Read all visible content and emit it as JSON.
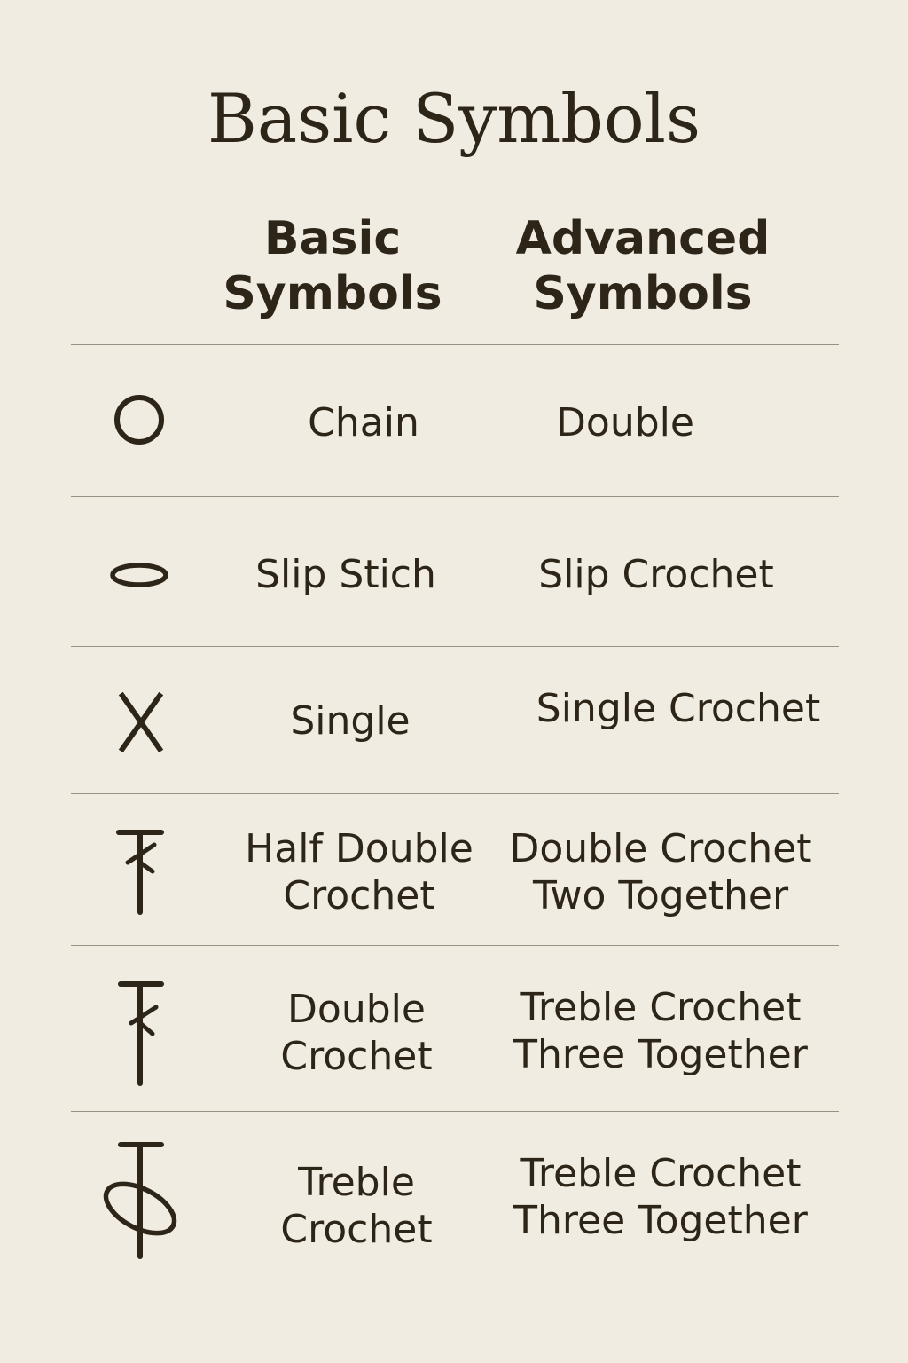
{
  "title": "Basic Symbols",
  "headers": {
    "basic": "Basic\nSymbols",
    "advanced": "Advanced\nSymbols"
  },
  "rows": [
    {
      "symbol_icon": "chain-icon",
      "basic": "Chain",
      "advanced": "Double"
    },
    {
      "symbol_icon": "slip-stitch-icon",
      "basic": "Slip Stich",
      "advanced": "Slip Crochet"
    },
    {
      "symbol_icon": "single-crochet-icon",
      "basic": "Single",
      "advanced": "Single Crochet"
    },
    {
      "symbol_icon": "half-double-crochet-icon",
      "basic": "Half Double\nCrochet",
      "advanced": "Double Crochet\nTwo Together"
    },
    {
      "symbol_icon": "double-crochet-icon",
      "basic": "Double\nCrochet",
      "advanced": "Treble Crochet\nThree Together"
    },
    {
      "symbol_icon": "treble-crochet-icon",
      "basic": "Treble\nCrochet",
      "advanced": "Treble Crochet\nThree Together"
    }
  ],
  "colors": {
    "background": "#f0ece2",
    "text": "#2e2519",
    "rule": "#9a9384"
  }
}
